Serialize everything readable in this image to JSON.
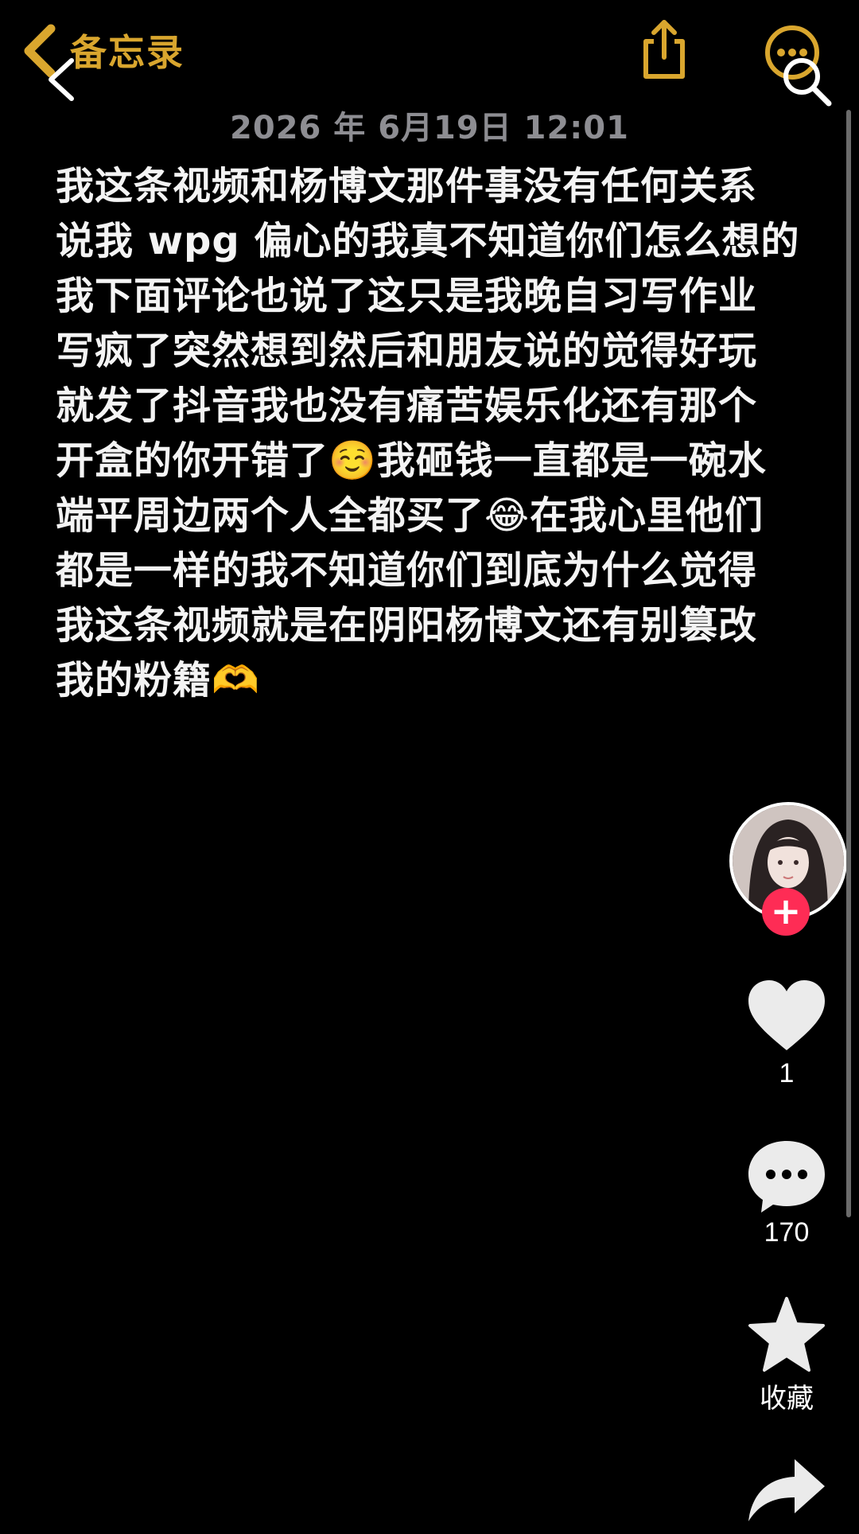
{
  "notes": {
    "back_label": "备忘录",
    "date": "2026 年 6月19日 12:01",
    "lines": [
      "我这条视频和杨博文那件事没有任何关系",
      "说我 wpg 偏心的我真不知道你们怎么想的",
      "我下面评论也说了这只是我晚自习写作业",
      "写疯了突然想到然后和朋友说的觉得好玩",
      "就发了抖音我也没有痛苦娱乐化还有那个",
      "开盒的你开错了☺️我砸钱一直都是一碗水",
      "端平周边两个人全都买了😂在我心里他们",
      "都是一样的我不知道你们到底为什么觉得",
      "我这条视频就是在阴阳杨博文还有别篡改",
      "我的粉籍🫶"
    ]
  },
  "rail": {
    "follow_symbol": "+",
    "like_count": "1",
    "comment_count": "170",
    "favorite_label": "收藏"
  },
  "colors": {
    "notes_accent": "#D9A62E",
    "follow_red": "#fe2c55",
    "date_gray": "#8d8d92"
  },
  "icons": [
    "notes-back-chevron-icon",
    "share-icon",
    "more-icon",
    "back-arrow-icon",
    "search-icon",
    "heart-icon",
    "comment-icon",
    "star-icon",
    "share-arrow-icon"
  ]
}
